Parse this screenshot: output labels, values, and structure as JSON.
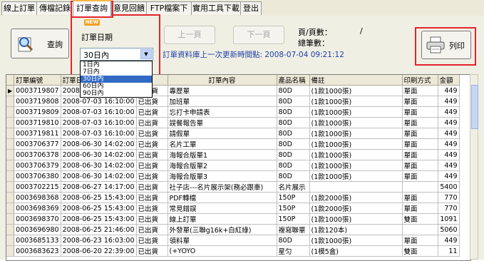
{
  "tabs": [
    "線上訂單",
    "傳檔記錄",
    "訂單查詢",
    "意見回饋",
    "FTP檔案下載",
    "實用工具下載",
    "登出"
  ],
  "new_badge": "NEW",
  "query_button": "查詢",
  "order_date_label": "訂單日期",
  "date_combo_value": "30日內",
  "date_options": [
    "1日內",
    "7日內",
    "30日內",
    "60日內",
    "90日內"
  ],
  "date_selected_index": 2,
  "prev_page": "上一頁",
  "next_page": "下一頁",
  "page_count_label": "頁/頁數：",
  "page_count_value": "/",
  "total_label": "總筆數：",
  "db_update": "訂單資料庫上一次更新時間點: 2008-07-04 09:21:12",
  "print_button": "列印",
  "columns": [
    "",
    "訂單編號",
    "訂單日期",
    "",
    "訂單內容",
    "產品名稱",
    "備註",
    "印刷方式",
    "金額"
  ],
  "rows": [
    [
      "0003719807",
      "2008-07-03 16:10:00",
      "已出貨",
      "專歷單",
      "80D",
      "(1款1000張)",
      "單面",
      "449"
    ],
    [
      "0003719808",
      "2008-07-03 16:10:00",
      "已出貨",
      "加班單",
      "80D",
      "(1款1000張)",
      "單面",
      "449"
    ],
    [
      "0003719809",
      "2008-07-03 16:10:00",
      "已出貨",
      "忘打卡申請表",
      "80D",
      "(1款1000張)",
      "單面",
      "449"
    ],
    [
      "0003719810",
      "2008-07-03 16:10:00",
      "已出貨",
      "誤餐報告單",
      "80D",
      "(1款1000張)",
      "單面",
      "449"
    ],
    [
      "0003719811",
      "2008-07-03 16:10:00",
      "已出貨",
      "請假單",
      "80D",
      "(1款1000張)",
      "單面",
      "449"
    ],
    [
      "0003706377",
      "2008-06-30 14:02:00",
      "已出貨",
      "名片工單",
      "80D",
      "(1款1000張)",
      "單面",
      "449"
    ],
    [
      "0003706378",
      "2008-06-30 14:02:00",
      "已出貨",
      "海報合版單1",
      "80D",
      "(1款1000張)",
      "單面",
      "449"
    ],
    [
      "0003706379",
      "2008-06-30 14:02:00",
      "已出貨",
      "海報合版單2",
      "80D",
      "(1款1000張)",
      "單面",
      "449"
    ],
    [
      "0003706380",
      "2008-06-30 14:02:00",
      "已出貨",
      "海報合版單3",
      "80D",
      "(1款1000張)",
      "單面",
      "449"
    ],
    [
      "0003702215",
      "2008-06-27 14:17:00",
      "已出貨",
      "社子店---名片展示架(務必跟車)",
      "名片展示",
      "",
      "",
      "5400"
    ],
    [
      "0003698368",
      "2008-06-25 15:43:00",
      "已出貨",
      "PDF轉檔",
      "150P",
      "(1款2000張)",
      "單面",
      "770"
    ],
    [
      "0003698369",
      "2008-06-25 15:43:00",
      "已出貨",
      "常見錯誤",
      "150P",
      "(1款2000張)",
      "單面",
      "770"
    ],
    [
      "0003698370",
      "2008-06-25 15:43:00",
      "已出貨",
      "線上訂單",
      "150P",
      "(1款1000張)",
      "雙面",
      "1091"
    ],
    [
      "0003696980",
      "2008-06-25 21:46:00",
      "已出貨",
      "外發單(三聯g16k+白紅綠)",
      "複寫聯單",
      "(1款120本)",
      "",
      "5060"
    ],
    [
      "0003685133",
      "2008-06-23 16:03:00",
      "已出貨",
      "領料單",
      "80D",
      "(1款1000張)",
      "單面",
      "449"
    ],
    [
      "0003683623",
      "2008-06-20 22:39:00",
      "已出貨",
      "(+YOYO",
      "星匀",
      "(1模5盒)",
      "雙面",
      "11"
    ]
  ]
}
